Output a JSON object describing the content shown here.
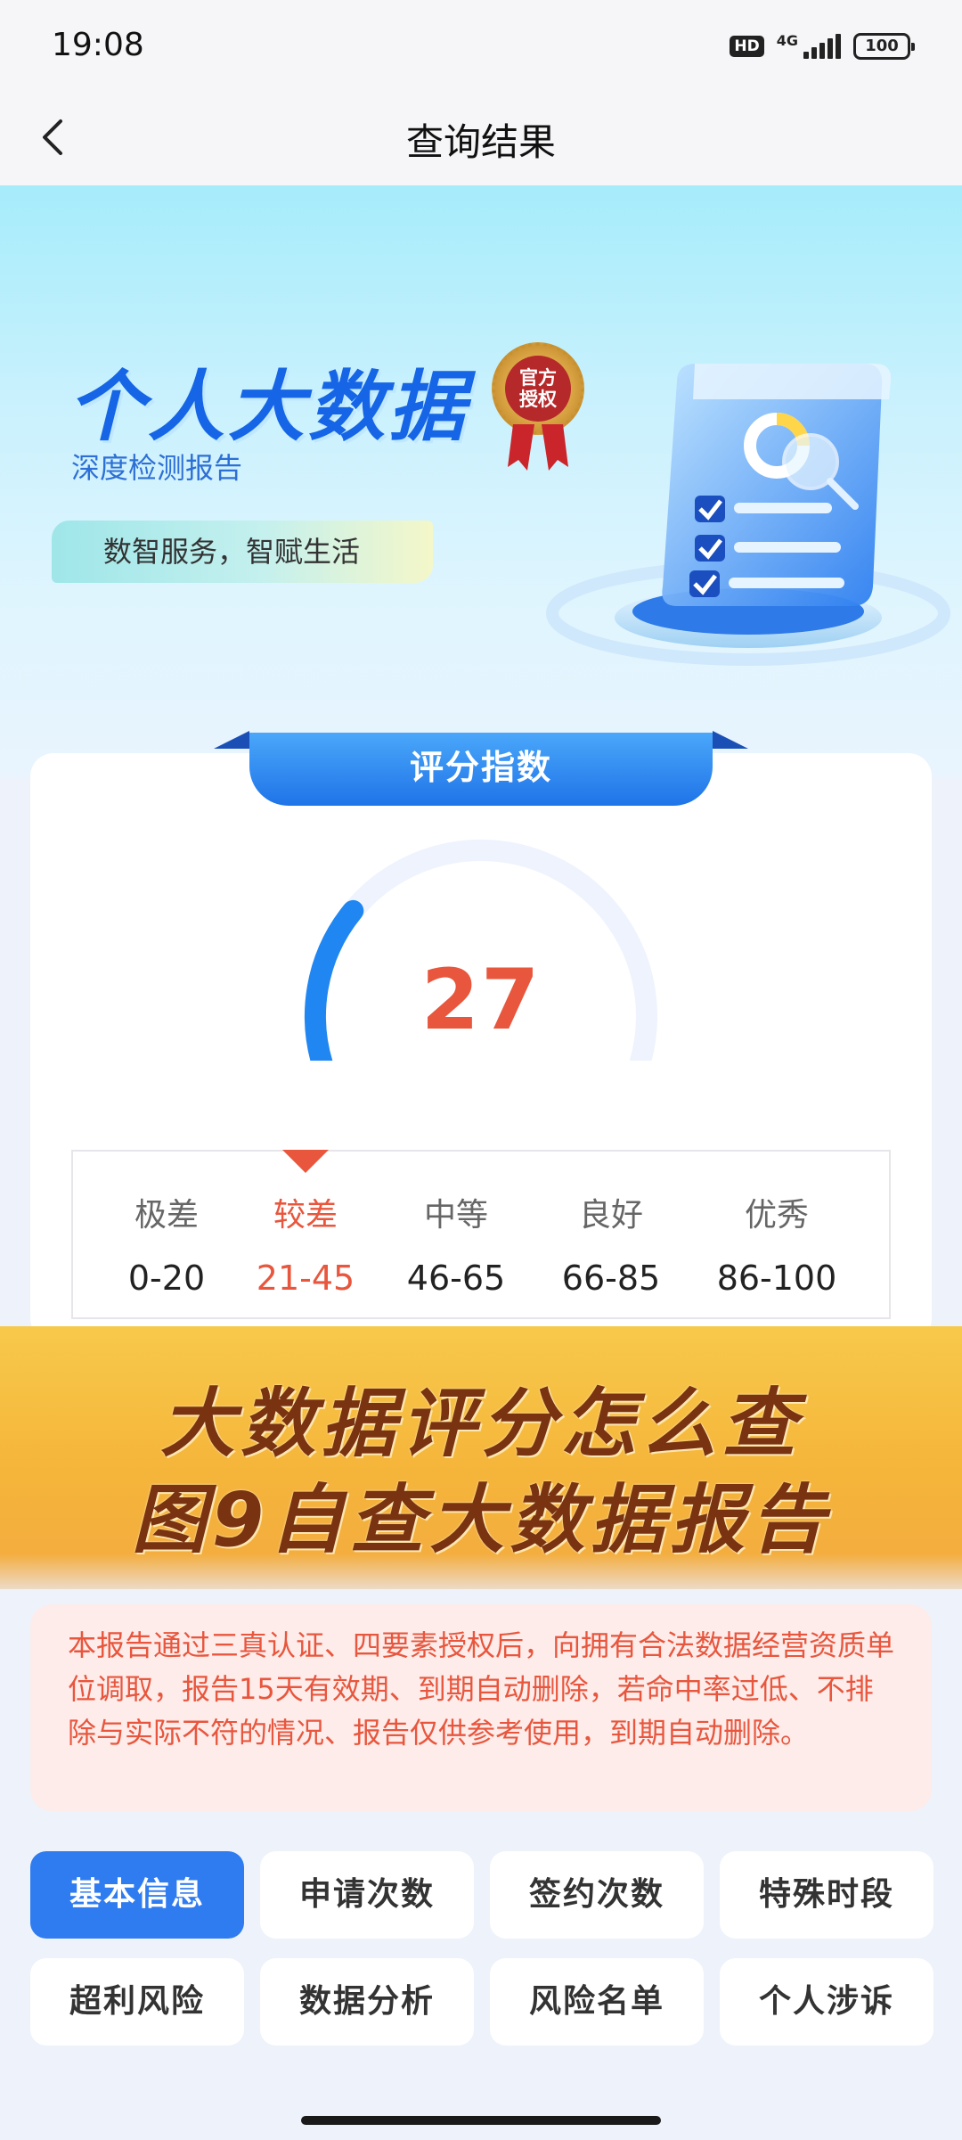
{
  "status_bar": {
    "time": "19:08",
    "hd_badge": "HD",
    "network": "4G",
    "battery": "100",
    "icons": [
      "hd-icon",
      "signal-icon",
      "battery-icon"
    ]
  },
  "nav": {
    "back_icon": "chevron-left-icon",
    "title": "查询结果"
  },
  "banner": {
    "title": "个人大数据",
    "seal_line1": "官方",
    "seal_line2": "授权",
    "subtitle": "深度检测报告",
    "slogan": "数智服务，智赋生活",
    "illustration_icon": "report-document-icon"
  },
  "score": {
    "tab_label": "评分指数",
    "value": "27",
    "value_numeric": 27,
    "max": 100,
    "gauge_colors": {
      "fill": "#1f86f2",
      "track": "#eef3fd"
    },
    "ratings": [
      {
        "name": "极差",
        "range": "0-20",
        "active": false
      },
      {
        "name": "较差",
        "range": "21-45",
        "active": true
      },
      {
        "name": "中等",
        "range": "46-65",
        "active": false
      },
      {
        "name": "良好",
        "range": "66-85",
        "active": false
      },
      {
        "name": "优秀",
        "range": "86-100",
        "active": false
      }
    ],
    "accent_color": "#e8563d"
  },
  "promo": {
    "line1": "大数据评分怎么查",
    "line2": "图9自查大数据报告"
  },
  "disclaimer": {
    "text": "本报告通过三真认证、四要素授权后，向拥有合法数据经营资质单位调取，报告15天有效期、到期自动删除，若命中率过低、不排除与实际不符的情况、报告仅供参考使用，到期自动删除。"
  },
  "tabs": [
    {
      "label": "基本信息",
      "active": true
    },
    {
      "label": "申请次数",
      "active": false
    },
    {
      "label": "签约次数",
      "active": false
    },
    {
      "label": "特殊时段",
      "active": false
    },
    {
      "label": "超利风险",
      "active": false
    },
    {
      "label": "数据分析",
      "active": false
    },
    {
      "label": "风险名单",
      "active": false
    },
    {
      "label": "个人涉诉",
      "active": false
    }
  ]
}
